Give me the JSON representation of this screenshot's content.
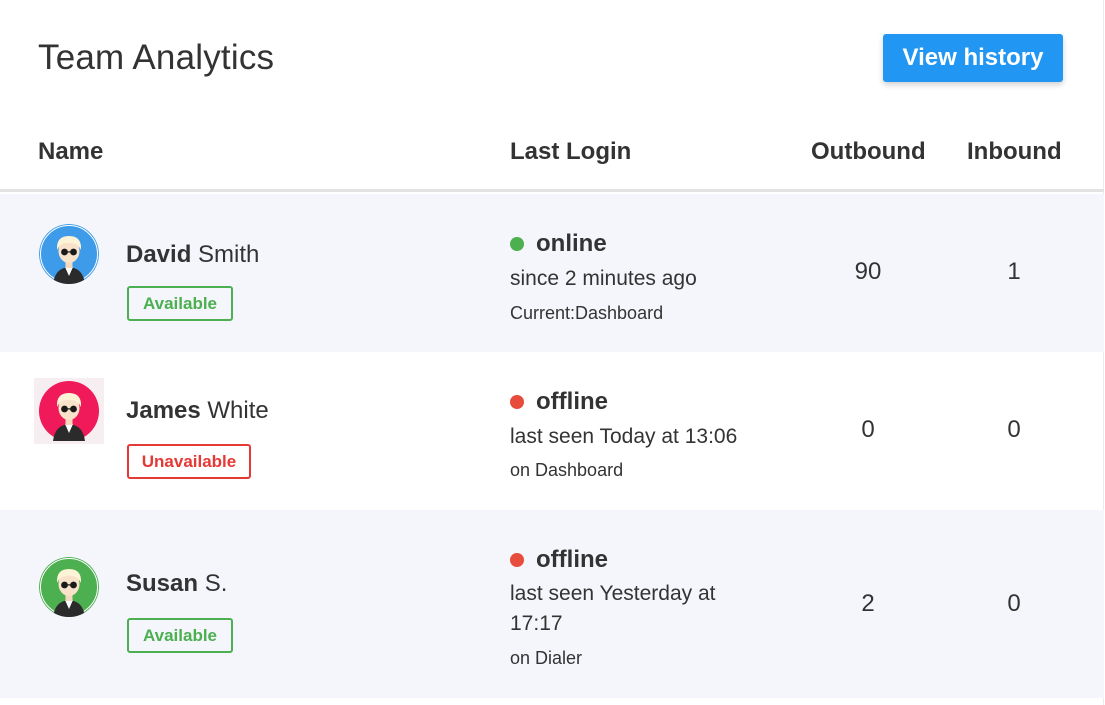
{
  "header": {
    "title": "Team Analytics",
    "history_button": "View history"
  },
  "columns": {
    "name": "Name",
    "last_login": "Last Login",
    "outbound": "Outbound",
    "inbound": "Inbound"
  },
  "rows": [
    {
      "first_name": "David",
      "last_name": "Smith",
      "avatar_color": "#3d9be9",
      "availability": "Available",
      "status": "online",
      "status_color": "#4caf50",
      "since": "since 2 minutes ago",
      "location": "Current:Dashboard",
      "outbound": "90",
      "inbound": "1"
    },
    {
      "first_name": "James",
      "last_name": "White",
      "avatar_color": "#f0195a",
      "availability": "Unavailable",
      "status": "offline",
      "status_color": "#e74c3c",
      "since": "last seen Today at 13:06",
      "location": "on Dashboard",
      "outbound": "0",
      "inbound": "0"
    },
    {
      "first_name": "Susan",
      "last_name": "S.",
      "avatar_color": "#4caf50",
      "availability": "Available",
      "status": "offline",
      "status_color": "#e74c3c",
      "since": "last seen Yesterday at 17:17",
      "location": "on Dialer",
      "outbound": "2",
      "inbound": "0"
    }
  ]
}
